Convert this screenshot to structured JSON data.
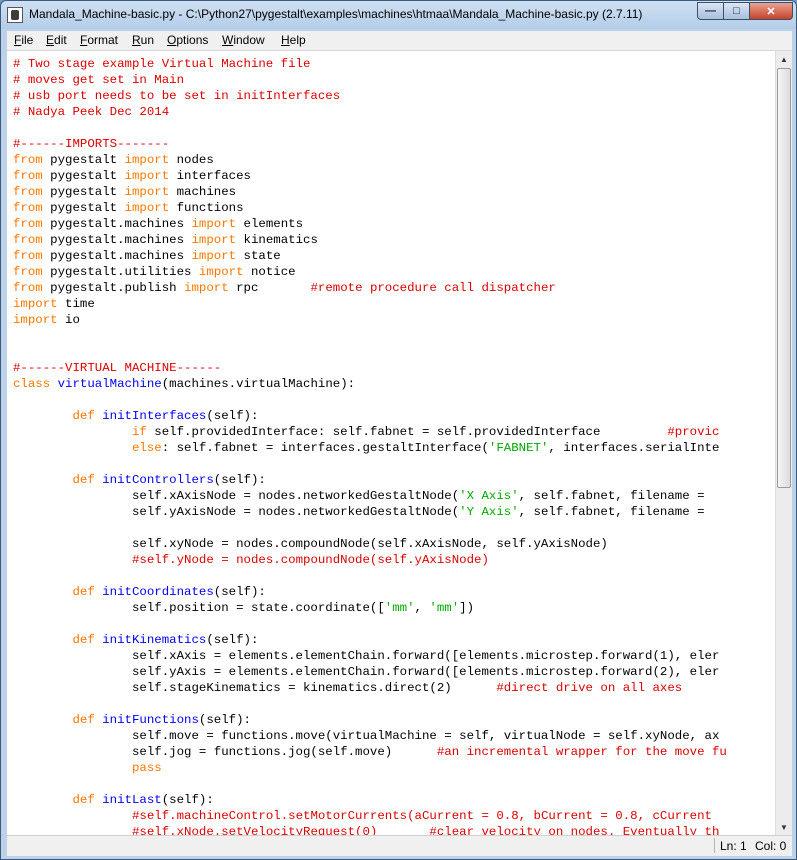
{
  "window": {
    "title": "Mandala_Machine-basic.py - C:\\Python27\\pygestalt\\examples\\machines\\htmaa\\Mandala_Machine-basic.py (2.7.11)",
    "controls": {
      "minimize": "—",
      "maximize": "□",
      "close": "✕"
    }
  },
  "menu": [
    "File",
    "Edit",
    "Format",
    "Run",
    "Options",
    "Window",
    "Help"
  ],
  "colors": {
    "keyword": "#ff7700",
    "comment": "#dd0000",
    "string": "#00aa00",
    "defname": "#0000ff"
  },
  "code_lines": [
    [
      [
        "c",
        "# Two stage example Virtual Machine file"
      ]
    ],
    [
      [
        "c",
        "# moves get set in Main"
      ]
    ],
    [
      [
        "c",
        "# usb port needs to be set in initInterfaces"
      ]
    ],
    [
      [
        "c",
        "# Nadya Peek Dec 2014"
      ]
    ],
    [],
    [
      [
        "c",
        "#------IMPORTS-------"
      ]
    ],
    [
      [
        "k",
        "from"
      ],
      [
        "p",
        " pygestalt "
      ],
      [
        "k",
        "import"
      ],
      [
        "p",
        " nodes"
      ]
    ],
    [
      [
        "k",
        "from"
      ],
      [
        "p",
        " pygestalt "
      ],
      [
        "k",
        "import"
      ],
      [
        "p",
        " interfaces"
      ]
    ],
    [
      [
        "k",
        "from"
      ],
      [
        "p",
        " pygestalt "
      ],
      [
        "k",
        "import"
      ],
      [
        "p",
        " machines"
      ]
    ],
    [
      [
        "k",
        "from"
      ],
      [
        "p",
        " pygestalt "
      ],
      [
        "k",
        "import"
      ],
      [
        "p",
        " functions"
      ]
    ],
    [
      [
        "k",
        "from"
      ],
      [
        "p",
        " pygestalt.machines "
      ],
      [
        "k",
        "import"
      ],
      [
        "p",
        " elements"
      ]
    ],
    [
      [
        "k",
        "from"
      ],
      [
        "p",
        " pygestalt.machines "
      ],
      [
        "k",
        "import"
      ],
      [
        "p",
        " kinematics"
      ]
    ],
    [
      [
        "k",
        "from"
      ],
      [
        "p",
        " pygestalt.machines "
      ],
      [
        "k",
        "import"
      ],
      [
        "p",
        " state"
      ]
    ],
    [
      [
        "k",
        "from"
      ],
      [
        "p",
        " pygestalt.utilities "
      ],
      [
        "k",
        "import"
      ],
      [
        "p",
        " notice"
      ]
    ],
    [
      [
        "k",
        "from"
      ],
      [
        "p",
        " pygestalt.publish "
      ],
      [
        "k",
        "import"
      ],
      [
        "p",
        " rpc       "
      ],
      [
        "c",
        "#remote procedure call dispatcher"
      ]
    ],
    [
      [
        "k",
        "import"
      ],
      [
        "p",
        " time"
      ]
    ],
    [
      [
        "k",
        "import"
      ],
      [
        "p",
        " io"
      ]
    ],
    [],
    [],
    [
      [
        "c",
        "#------VIRTUAL MACHINE------"
      ]
    ],
    [
      [
        "k",
        "class"
      ],
      [
        "p",
        " "
      ],
      [
        "f",
        "virtualMachine"
      ],
      [
        "p",
        "(machines.virtualMachine):"
      ]
    ],
    [],
    [
      [
        "p",
        "        "
      ],
      [
        "k",
        "def"
      ],
      [
        "p",
        " "
      ],
      [
        "f",
        "initInterfaces"
      ],
      [
        "p",
        "(self):"
      ]
    ],
    [
      [
        "p",
        "                "
      ],
      [
        "k",
        "if"
      ],
      [
        "p",
        " self.providedInterface: self.fabnet = self.providedInterface         "
      ],
      [
        "c",
        "#provic"
      ]
    ],
    [
      [
        "p",
        "                "
      ],
      [
        "k",
        "else"
      ],
      [
        "p",
        ": self.fabnet = interfaces.gestaltInterface("
      ],
      [
        "s",
        "'FABNET'"
      ],
      [
        "p",
        ", interfaces.serialInte"
      ]
    ],
    [],
    [
      [
        "p",
        "        "
      ],
      [
        "k",
        "def"
      ],
      [
        "p",
        " "
      ],
      [
        "f",
        "initControllers"
      ],
      [
        "p",
        "(self):"
      ]
    ],
    [
      [
        "p",
        "                self.xAxisNode = nodes.networkedGestaltNode("
      ],
      [
        "s",
        "'X Axis'"
      ],
      [
        "p",
        ", self.fabnet, filename ="
      ]
    ],
    [
      [
        "p",
        "                self.yAxisNode = nodes.networkedGestaltNode("
      ],
      [
        "s",
        "'Y Axis'"
      ],
      [
        "p",
        ", self.fabnet, filename ="
      ]
    ],
    [],
    [
      [
        "p",
        "                self.xyNode = nodes.compoundNode(self.xAxisNode, self.yAxisNode)"
      ]
    ],
    [
      [
        "p",
        "                "
      ],
      [
        "c",
        "#self.yNode = nodes.compoundNode(self.yAxisNode)"
      ]
    ],
    [],
    [
      [
        "p",
        "        "
      ],
      [
        "k",
        "def"
      ],
      [
        "p",
        " "
      ],
      [
        "f",
        "initCoordinates"
      ],
      [
        "p",
        "(self):"
      ]
    ],
    [
      [
        "p",
        "                self.position = state.coordinate(["
      ],
      [
        "s",
        "'mm'"
      ],
      [
        "p",
        ", "
      ],
      [
        "s",
        "'mm'"
      ],
      [
        "p",
        "])"
      ]
    ],
    [],
    [
      [
        "p",
        "        "
      ],
      [
        "k",
        "def"
      ],
      [
        "p",
        " "
      ],
      [
        "f",
        "initKinematics"
      ],
      [
        "p",
        "(self):"
      ]
    ],
    [
      [
        "p",
        "                self.xAxis = elements.elementChain.forward([elements.microstep.forward(1), eler"
      ]
    ],
    [
      [
        "p",
        "                self.yAxis = elements.elementChain.forward([elements.microstep.forward(2), eler"
      ]
    ],
    [
      [
        "p",
        "                self.stageKinematics = kinematics.direct(2)      "
      ],
      [
        "c",
        "#direct drive on all axes"
      ]
    ],
    [],
    [
      [
        "p",
        "        "
      ],
      [
        "k",
        "def"
      ],
      [
        "p",
        " "
      ],
      [
        "f",
        "initFunctions"
      ],
      [
        "p",
        "(self):"
      ]
    ],
    [
      [
        "p",
        "                self.move = functions.move(virtualMachine = self, virtualNode = self.xyNode, ax"
      ]
    ],
    [
      [
        "p",
        "                self.jog = functions.jog(self.move)      "
      ],
      [
        "c",
        "#an incremental wrapper for the move fu"
      ]
    ],
    [
      [
        "p",
        "                "
      ],
      [
        "k",
        "pass"
      ]
    ],
    [],
    [
      [
        "p",
        "        "
      ],
      [
        "k",
        "def"
      ],
      [
        "p",
        " "
      ],
      [
        "f",
        "initLast"
      ],
      [
        "p",
        "(self):"
      ]
    ],
    [
      [
        "p",
        "                "
      ],
      [
        "c",
        "#self.machineControl.setMotorCurrents(aCurrent = 0.8, bCurrent = 0.8, cCurrent"
      ]
    ],
    [
      [
        "p",
        "                "
      ],
      [
        "c",
        "#self.xNode.setVelocityRequest(0)       #clear velocity on nodes. Eventually th"
      ]
    ]
  ],
  "status": {
    "line": "Ln: 1",
    "col": "Col: 0"
  },
  "scrollbar": {
    "up_icon": "▲",
    "down_icon": "▼",
    "position_fraction": 0
  }
}
